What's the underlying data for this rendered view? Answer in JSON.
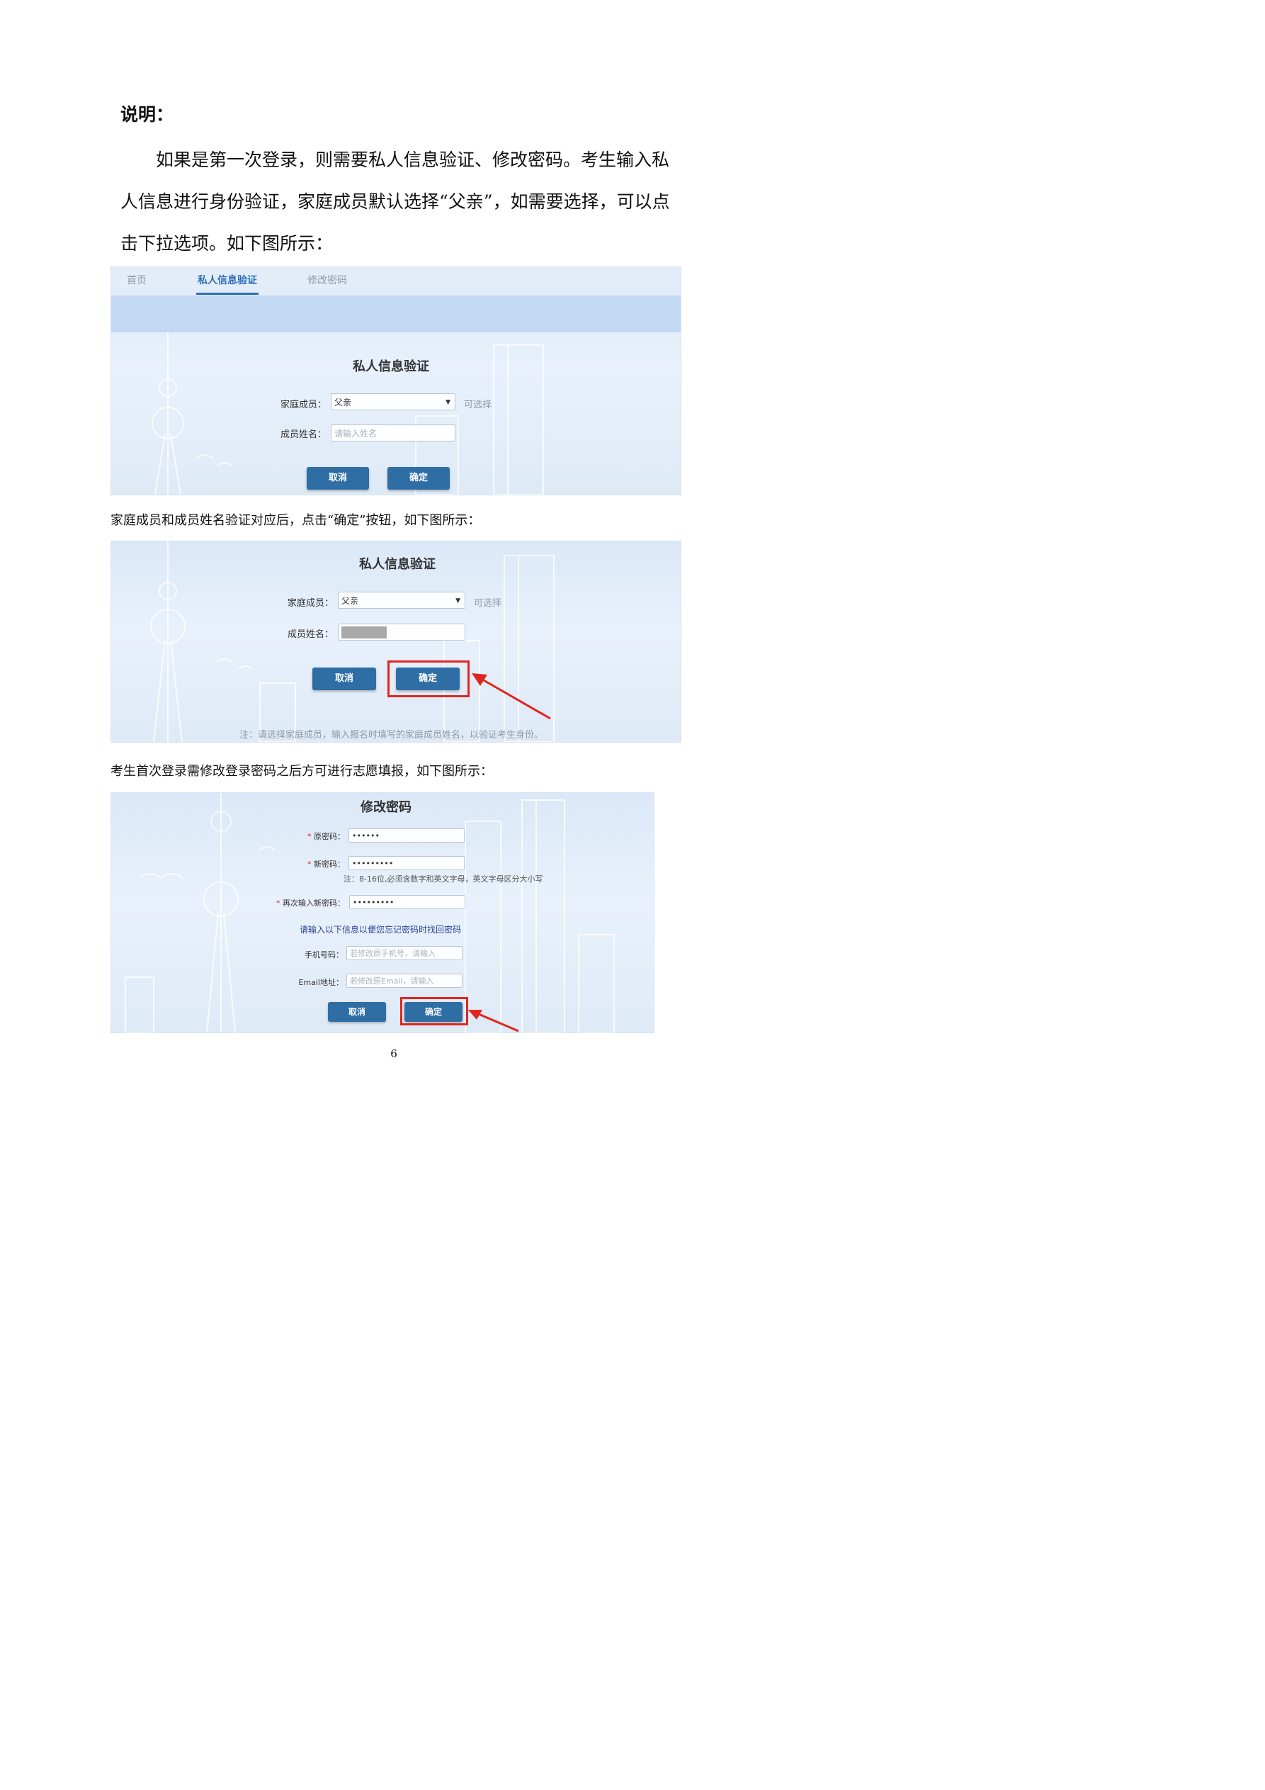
{
  "doc": {
    "heading": "说明：",
    "paragraph": "如果是第一次登录，则需要私人信息验证、修改密码。考生输入私人信息进行身份验证，家庭成员默认选择“父亲”，如需要选择，可以点击下拉选项。如下图所示：",
    "caption1": "家庭成员和成员姓名验证对应后，点击“确定”按钮，如下图所示：",
    "caption2": "考生首次登录需修改登录密码之后方可进行志愿填报，如下图所示：",
    "page_number": "6"
  },
  "shot1": {
    "tabs": [
      "首页",
      "私人信息验证",
      "修改密码"
    ],
    "active_tab": "私人信息验证",
    "form_title": "私人信息验证",
    "family_label": "家庭成员：",
    "family_value": "父亲",
    "selectable_hint": "可选择",
    "name_label": "成员姓名：",
    "name_placeholder": "请输入姓名",
    "cancel": "取消",
    "confirm": "确定"
  },
  "shot2": {
    "form_title": "私人信息验证",
    "family_label": "家庭成员：",
    "family_value": "父亲",
    "selectable_hint": "可选择",
    "name_label": "成员姓名：",
    "cancel": "取消",
    "confirm": "确定",
    "note": "注：请选择家庭成员，输入报名时填写的家庭成员姓名，以验证考生身份。"
  },
  "shot3": {
    "form_title": "修改密码",
    "required_mark": "*",
    "old_pwd_label": "原密码：",
    "old_pwd_value": "••••••",
    "new_pwd_label": "新密码：",
    "new_pwd_value": "•••••••••",
    "pwd_rule": "注：8-16位,必须含数字和英文字母，英文字母区分大小写",
    "repeat_label": "再次输入新密码：",
    "repeat_value": "•••••••••",
    "recovery_note": "请输入以下信息以便您忘记密码时找回密码",
    "phone_label": "手机号码：",
    "phone_placeholder": "若修改原手机号，请输入",
    "email_label": "Email地址：",
    "email_placeholder": "若修改原Email，请输入",
    "cancel": "取消",
    "confirm": "确定"
  },
  "colors": {
    "button_blue": "#2f6ea5",
    "highlight_red": "#e0261f",
    "tab_active": "#2d6db6",
    "background_blue": "#dbe8f7"
  }
}
